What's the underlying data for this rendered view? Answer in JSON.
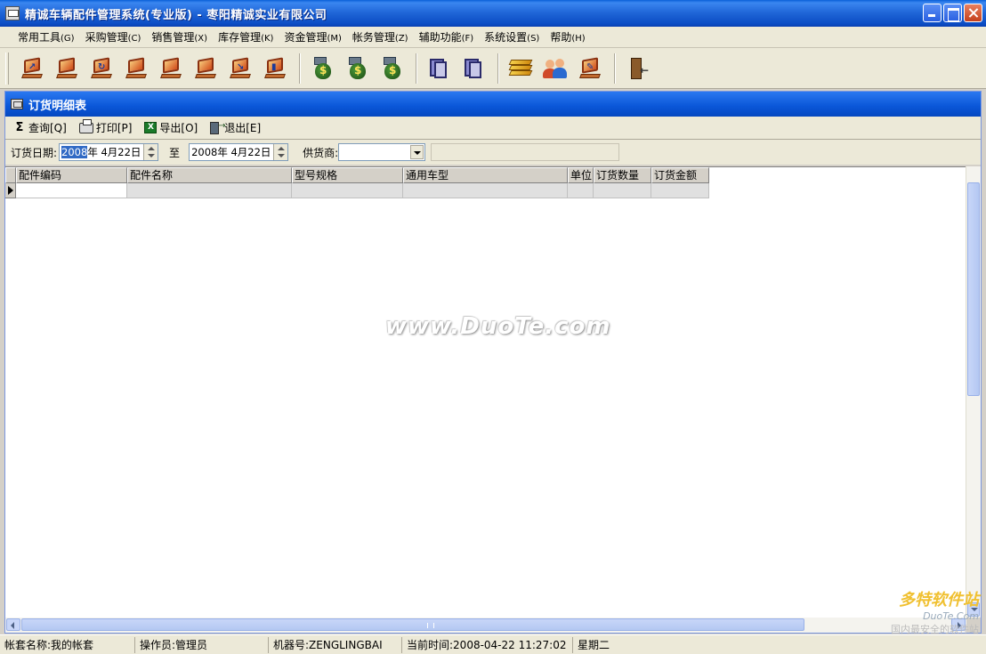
{
  "window": {
    "title": "精诚车辆配件管理系统(专业版)  -  枣阳精诚实业有限公司"
  },
  "menu": [
    {
      "label": "常用工具",
      "key": "(G)"
    },
    {
      "label": "采购管理",
      "key": "(C)"
    },
    {
      "label": "销售管理",
      "key": "(X)"
    },
    {
      "label": "库存管理",
      "key": "(K)"
    },
    {
      "label": "资金管理",
      "key": "(M)"
    },
    {
      "label": "帐务管理",
      "key": "(Z)"
    },
    {
      "label": "辅助功能",
      "key": "(F)"
    },
    {
      "label": "系统设置",
      "key": "(S)"
    },
    {
      "label": "帮助",
      "key": "(H)"
    }
  ],
  "toolbar_icons": [
    "monitor-arrow-icon",
    "monitor-icon",
    "monitor-refresh-icon",
    "monitor-icon",
    "monitor-icon",
    "monitor-icon",
    "monitor-arrow-icon",
    "monitor-chart-icon",
    "money-bag-icon",
    "money-bag-icon",
    "money-bag-icon",
    "document-icon",
    "document-copy-icon",
    "books-icon",
    "users-icon",
    "monitor-edit-icon",
    "exit-door-icon"
  ],
  "child_window": {
    "title": "订货明细表"
  },
  "actions": {
    "query": "查询[Q]",
    "print": "打印[P]",
    "export": "导出[O]",
    "exit": "退出[E]"
  },
  "filter": {
    "date_label": "订货日期:",
    "from_year": "2008",
    "from_rest": "年  4月22日",
    "to_word": "至",
    "to_date": "2008年  4月22日",
    "supplier_label": "供货商:",
    "supplier_value": ""
  },
  "grid": {
    "columns": [
      "配件编码",
      "配件名称",
      "型号规格",
      "通用车型",
      "单位",
      "订货数量",
      "订货金额"
    ],
    "rows": [
      [
        "",
        "",
        "",
        "",
        "",
        "",
        ""
      ]
    ]
  },
  "watermark": "www.DuoTe.com",
  "corner_logo": {
    "brand": "多特软件站",
    "domain": "DuoTe.Com",
    "slogan": "国内最安全的软件站"
  },
  "status": {
    "account": "帐套名称:我的帐套",
    "operator": "操作员:管理员",
    "machine": "机器号:ZENGLINGBAI",
    "time": "当前时间:2008-04-22 11:27:02",
    "weekday": "星期二"
  },
  "colors": {
    "titlebar": "#0b4cc4",
    "face": "#ece9d8",
    "selection": "#316ac5"
  }
}
